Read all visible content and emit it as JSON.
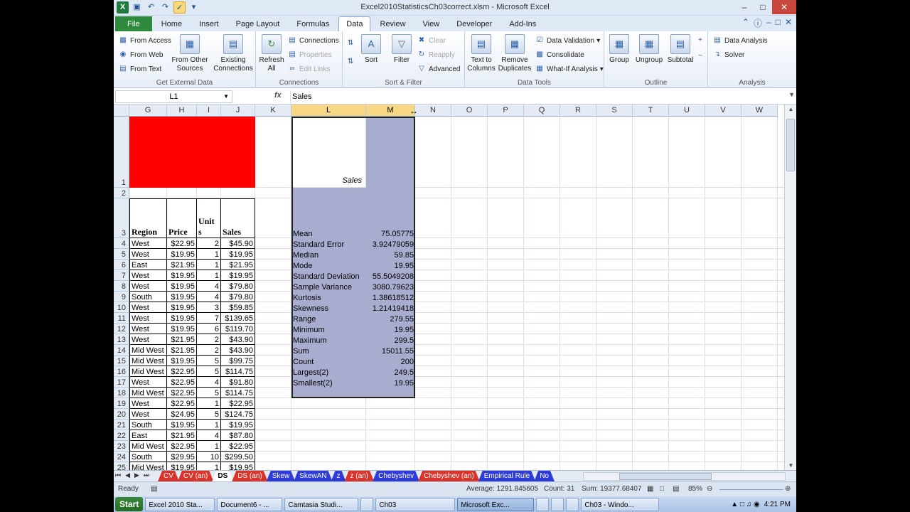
{
  "window": {
    "title": "Excel2010StatisticsCh03correct.xlsm - Microsoft Excel"
  },
  "qat": {
    "excel_icon": "X",
    "save_icon": "save-icon",
    "undo_icon": "undo-icon",
    "redo_icon": "redo-icon",
    "macro_icon": "macro-icon",
    "more_icon": "customize-icon"
  },
  "tabs": [
    "File",
    "Home",
    "Insert",
    "Page Layout",
    "Formulas",
    "Data",
    "Review",
    "View",
    "Developer",
    "Add-Ins"
  ],
  "ribbon": {
    "external": {
      "label": "Get External Data",
      "from_access": "From Access",
      "from_web": "From Web",
      "from_text": "From Text",
      "other_sources": "From Other Sources",
      "existing": "Existing Connections"
    },
    "connections": {
      "label": "Connections",
      "refresh": "Refresh All",
      "connections": "Connections",
      "properties": "Properties",
      "edit_links": "Edit Links"
    },
    "sort": {
      "label": "Sort & Filter",
      "sort": "Sort",
      "filter": "Filter",
      "clear": "Clear",
      "reapply": "Reapply",
      "advanced": "Advanced"
    },
    "tools": {
      "label": "Data Tools",
      "text_to_columns": "Text to Columns",
      "remove_dup": "Remove Duplicates",
      "validation": "Data Validation",
      "consolidate": "Consolidate",
      "whatif": "What-If Analysis"
    },
    "outline": {
      "label": "Outline",
      "group": "Group",
      "ungroup": "Ungroup",
      "subtotal": "Subtotal"
    },
    "analysis": {
      "label": "Analysis",
      "data_analysis": "Data Analysis",
      "solver": "Solver"
    }
  },
  "formula_bar": {
    "name_box": "L1",
    "fx": "fx",
    "content": "Sales"
  },
  "columns": [
    "G",
    "H",
    "I",
    "J",
    "K",
    "L",
    "M",
    "N",
    "O",
    "P",
    "Q",
    "R",
    "S",
    "T",
    "U",
    "V",
    "W"
  ],
  "rows": [
    "1",
    "2",
    "3",
    "4",
    "5",
    "6",
    "7",
    "8",
    "9",
    "10",
    "11",
    "12",
    "13",
    "14",
    "15",
    "16",
    "17",
    "18",
    "19",
    "20",
    "21",
    "22",
    "23",
    "24",
    "25"
  ],
  "table": {
    "headers": [
      "Region",
      "Price",
      "Unit s",
      "Sales"
    ],
    "rows": [
      [
        "West",
        "$22.95",
        "2",
        "$45.90"
      ],
      [
        "West",
        "$19.95",
        "1",
        "$19.95"
      ],
      [
        "East",
        "$21.95",
        "1",
        "$21.95"
      ],
      [
        "West",
        "$19.95",
        "1",
        "$19.95"
      ],
      [
        "West",
        "$19.95",
        "4",
        "$79.80"
      ],
      [
        "South",
        "$19.95",
        "4",
        "$79.80"
      ],
      [
        "West",
        "$19.95",
        "3",
        "$59.85"
      ],
      [
        "West",
        "$19.95",
        "7",
        "$139.65"
      ],
      [
        "West",
        "$19.95",
        "6",
        "$119.70"
      ],
      [
        "West",
        "$21.95",
        "2",
        "$43.90"
      ],
      [
        "Mid West",
        "$21.95",
        "2",
        "$43.90"
      ],
      [
        "Mid West",
        "$19.95",
        "5",
        "$99.75"
      ],
      [
        "Mid West",
        "$22.95",
        "5",
        "$114.75"
      ],
      [
        "West",
        "$22.95",
        "4",
        "$91.80"
      ],
      [
        "Mid West",
        "$22.95",
        "5",
        "$114.75"
      ],
      [
        "West",
        "$22.95",
        "1",
        "$22.95"
      ],
      [
        "West",
        "$24.95",
        "5",
        "$124.75"
      ],
      [
        "South",
        "$19.95",
        "1",
        "$19.95"
      ],
      [
        "East",
        "$21.95",
        "4",
        "$87.80"
      ],
      [
        "Mid West",
        "$22.95",
        "1",
        "$22.95"
      ],
      [
        "South",
        "$29.95",
        "10",
        "$299.50"
      ],
      [
        "Mid West",
        "$19.95",
        "1",
        "$19.95"
      ]
    ]
  },
  "stats": {
    "title": "Sales",
    "rows": [
      [
        "Mean",
        "75.05775"
      ],
      [
        "Standard Error",
        "3.92479059"
      ],
      [
        "Median",
        "59.85"
      ],
      [
        "Mode",
        "19.95"
      ],
      [
        "Standard Deviation",
        "55.5049208"
      ],
      [
        "Sample Variance",
        "3080.79623"
      ],
      [
        "Kurtosis",
        "1.38618512"
      ],
      [
        "Skewness",
        "1.21419418"
      ],
      [
        "Range",
        "279.55"
      ],
      [
        "Minimum",
        "19.95"
      ],
      [
        "Maximum",
        "299.5"
      ],
      [
        "Sum",
        "15011.55"
      ],
      [
        "Count",
        "200"
      ],
      [
        "Largest(2)",
        "249.5"
      ],
      [
        "Smallest(2)",
        "19.95"
      ]
    ]
  },
  "sheet_tabs": [
    {
      "name": "CV",
      "color": "#d9342b"
    },
    {
      "name": "CV (an)",
      "color": "#d9342b"
    },
    {
      "name": "DS",
      "color": "#d9342b"
    },
    {
      "name": "DS (an)",
      "color": "#d9342b"
    },
    {
      "name": "Skew",
      "color": "#2e3bd6"
    },
    {
      "name": "SkewAN",
      "color": "#2e3bd6"
    },
    {
      "name": "z",
      "color": "#2e3bd6"
    },
    {
      "name": "z (an)",
      "color": "#d9342b"
    },
    {
      "name": "Chebyshev",
      "color": "#2e3bd6"
    },
    {
      "name": "Chebyshev (an)",
      "color": "#d9342b"
    },
    {
      "name": "Empirical Rule",
      "color": "#2e3bd6"
    },
    {
      "name": "No",
      "color": "#2e3bd6"
    }
  ],
  "status": {
    "ready": "Ready",
    "average": "Average: 1291.845605",
    "count": "Count: 31",
    "sum": "Sum: 19377.68407",
    "zoom": "85%"
  },
  "taskbar": {
    "start": "Start",
    "items": [
      "Excel 2010 Sta...",
      "Document6 - ...",
      "Camtasia Studi...",
      "",
      "Ch03",
      "Microsoft Exc...",
      "",
      "",
      "",
      "Ch03 - Windo..."
    ],
    "clock": "4:21 PM"
  }
}
